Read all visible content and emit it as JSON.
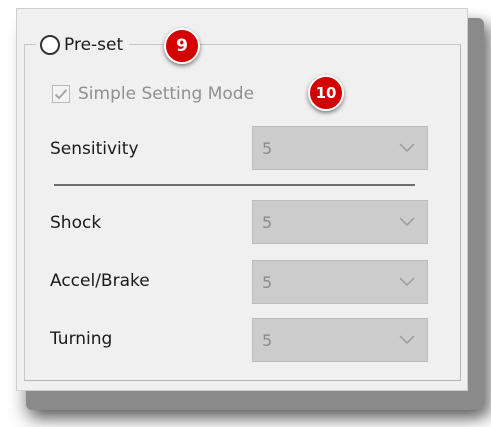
{
  "preset": {
    "radio_label": "Pre-set",
    "badge_9": "9",
    "badge_10": "10",
    "simple_mode_label": "Simple Setting Mode"
  },
  "sensitivity": {
    "label": "Sensitivity",
    "value": "5"
  },
  "shock": {
    "label": "Shock",
    "value": "5"
  },
  "accel_brake": {
    "label": "Accel/Brake",
    "value": "5"
  },
  "turning": {
    "label": "Turning",
    "value": "5"
  },
  "colors": {
    "badge": "#d40000",
    "disabled_text": "#8f8f8f",
    "select_bg": "#cccccc"
  },
  "icons": {
    "dropdown": "chevron-down-icon",
    "check": "checkmark-icon"
  }
}
